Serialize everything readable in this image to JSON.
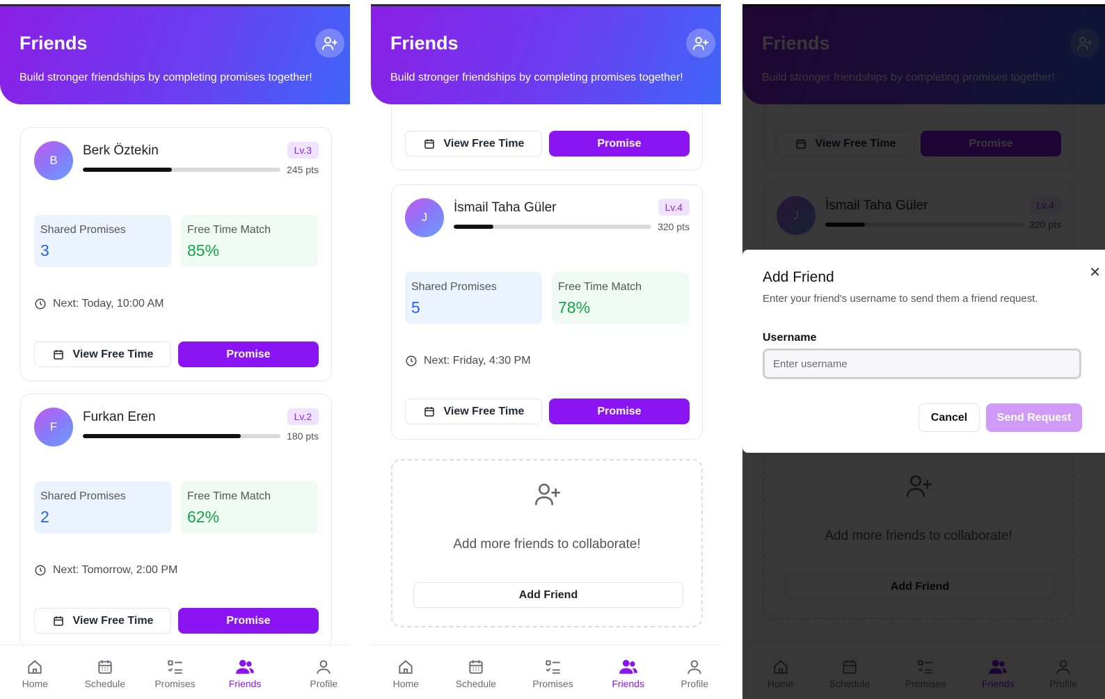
{
  "header": {
    "title": "Friends",
    "subtitle": "Build stronger friendships by completing promises together!",
    "add_icon": "user-plus-icon"
  },
  "friends": [
    {
      "initial": "B",
      "name": "Berk Öztekin",
      "level": "Lv.3",
      "points": "245 pts",
      "progress": 0.45,
      "shared_label": "Shared Promises",
      "shared": "3",
      "match_label": "Free Time Match",
      "match": "85%",
      "next": "Next: Today, 10:00 AM"
    },
    {
      "initial": "F",
      "name": "Furkan Eren",
      "level": "Lv.2",
      "points": "180 pts",
      "progress": 0.8,
      "shared_label": "Shared Promises",
      "shared": "2",
      "match_label": "Free Time Match",
      "match": "62%",
      "next": "Next: Tomorrow, 2:00 PM"
    },
    {
      "initial": "J",
      "name": "İsmail Taha Güler",
      "level": "Lv.4",
      "points": "320 pts",
      "progress": 0.2,
      "shared_label": "Shared Promises",
      "shared": "5",
      "match_label": "Free Time Match",
      "match": "78%",
      "next": "Next: Friday, 4:30 PM"
    }
  ],
  "actions": {
    "view_free_time": "View Free Time",
    "promise": "Promise"
  },
  "cta": {
    "text": "Add more friends to collaborate!",
    "button": "Add Friend"
  },
  "nav": [
    {
      "label": "Home",
      "icon": "home-icon"
    },
    {
      "label": "Schedule",
      "icon": "calendar-icon"
    },
    {
      "label": "Promises",
      "icon": "checklist-icon"
    },
    {
      "label": "Friends",
      "icon": "users-icon"
    },
    {
      "label": "Profile",
      "icon": "user-icon"
    }
  ],
  "modal": {
    "title": "Add Friend",
    "description": "Enter your friend's username to send them a friend request.",
    "username_label": "Username",
    "username_placeholder": "Enter username",
    "username_value": "",
    "cancel": "Cancel",
    "send": "Send Request"
  },
  "colors": {
    "accent": "#8b14f2",
    "header_start": "#8b1fe6",
    "header_end": "#3f66f7",
    "active_nav": "#8b14f2"
  }
}
